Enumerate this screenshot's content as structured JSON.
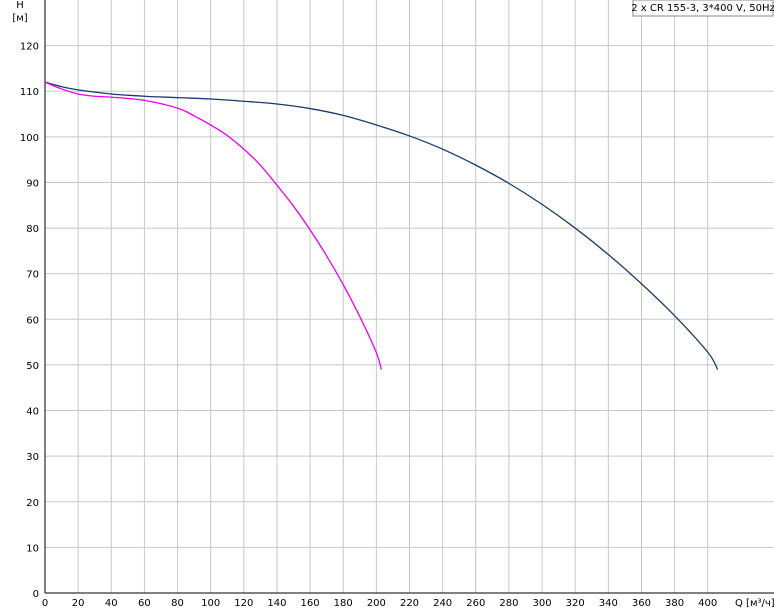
{
  "chart_data": {
    "type": "line",
    "title": "",
    "legend_text": "2 x CR 155-3, 3*400 V, 50Hz",
    "legend_position": "top-right",
    "xlabel": "Q [м³/ч]",
    "ylabel_top": "H",
    "ylabel_unit": "[м]",
    "xlim": [
      0,
      440
    ],
    "ylim": [
      0,
      130
    ],
    "x_ticks": [
      0,
      20,
      40,
      60,
      80,
      100,
      120,
      140,
      160,
      180,
      200,
      220,
      240,
      260,
      280,
      300,
      320,
      340,
      360,
      380,
      400
    ],
    "y_ticks": [
      0,
      10,
      20,
      30,
      40,
      50,
      60,
      70,
      80,
      90,
      100,
      110,
      120
    ],
    "grid": true,
    "series": [
      {
        "color": "#1a3a6b",
        "points": [
          [
            0,
            112
          ],
          [
            10,
            111
          ],
          [
            20,
            110.3
          ],
          [
            40,
            109.4
          ],
          [
            60,
            108.9
          ],
          [
            80,
            108.6
          ],
          [
            100,
            108.3
          ],
          [
            120,
            107.8
          ],
          [
            140,
            107.2
          ],
          [
            160,
            106.2
          ],
          [
            180,
            104.7
          ],
          [
            200,
            102.6
          ],
          [
            220,
            100.2
          ],
          [
            240,
            97.3
          ],
          [
            260,
            93.8
          ],
          [
            280,
            89.8
          ],
          [
            300,
            85.2
          ],
          [
            320,
            80
          ],
          [
            340,
            74.2
          ],
          [
            360,
            67.8
          ],
          [
            380,
            60.8
          ],
          [
            400,
            52.8
          ],
          [
            406,
            49
          ]
        ]
      },
      {
        "color": "#ee00ee",
        "points": [
          [
            0,
            112
          ],
          [
            10,
            110.5
          ],
          [
            20,
            109.4
          ],
          [
            30,
            108.9
          ],
          [
            40,
            108.7
          ],
          [
            60,
            108
          ],
          [
            80,
            106.3
          ],
          [
            90,
            104.6
          ],
          [
            100,
            102.6
          ],
          [
            110,
            100.3
          ],
          [
            120,
            97.3
          ],
          [
            130,
            93.8
          ],
          [
            140,
            89.4
          ],
          [
            150,
            84.8
          ],
          [
            160,
            79.6
          ],
          [
            170,
            73.9
          ],
          [
            180,
            67.6
          ],
          [
            190,
            60.6
          ],
          [
            200,
            52.7
          ],
          [
            203,
            49
          ]
        ]
      }
    ]
  }
}
